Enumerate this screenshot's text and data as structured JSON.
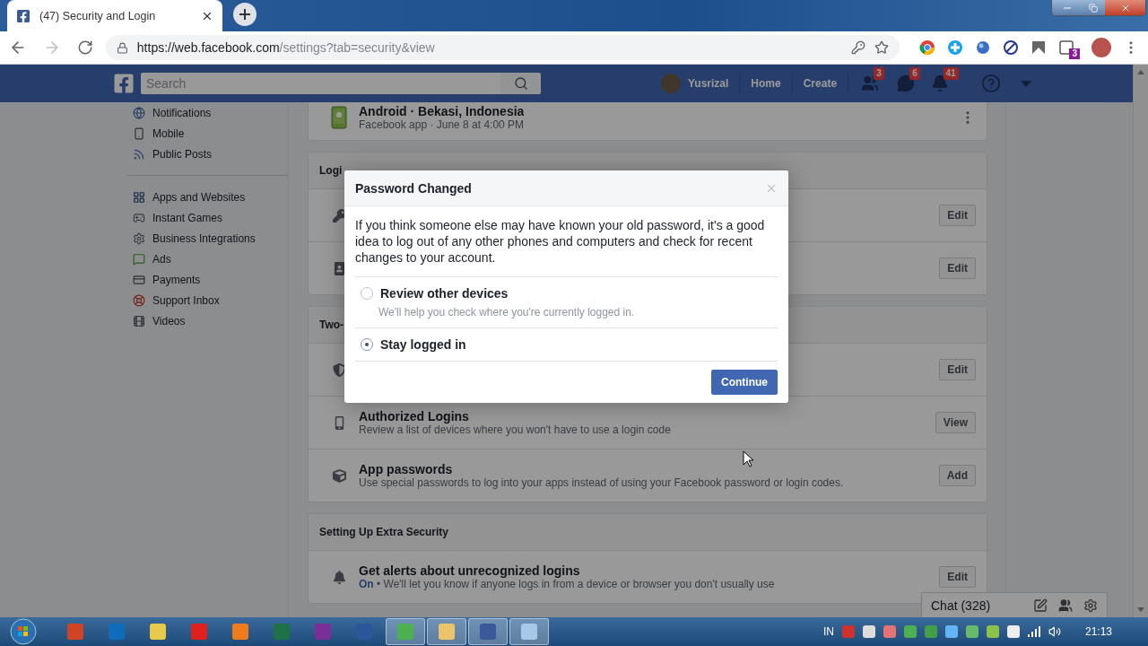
{
  "browser": {
    "tab_title": "(47) Security and Login",
    "url": {
      "host": "https://web.facebook.com",
      "path": "/settings?tab=security&view"
    },
    "extension_badge": "3"
  },
  "fb_header": {
    "search_placeholder": "Search",
    "user": "Yusrizal",
    "nav": [
      "Home",
      "Create"
    ],
    "badges": [
      {
        "kind": "friends",
        "count": "3"
      },
      {
        "kind": "messages",
        "count": "6"
      },
      {
        "kind": "notifications",
        "count": "41"
      }
    ]
  },
  "sidebar": {
    "groups": [
      [
        {
          "kind": "globe",
          "label": "Notifications"
        },
        {
          "kind": "phone",
          "label": "Mobile"
        },
        {
          "kind": "rss",
          "label": "Public Posts"
        }
      ],
      [
        {
          "kind": "apps",
          "label": "Apps and Websites"
        },
        {
          "kind": "games",
          "label": "Instant Games"
        },
        {
          "kind": "business",
          "label": "Business Integrations"
        },
        {
          "kind": "ads",
          "label": "Ads"
        },
        {
          "kind": "payments",
          "label": "Payments"
        },
        {
          "kind": "support",
          "label": "Support Inbox"
        },
        {
          "kind": "videos",
          "label": "Videos"
        }
      ]
    ]
  },
  "panels": [
    {
      "rows": [
        {
          "kind": "android",
          "title": "Android · Bekasi, Indonesia",
          "subtitle": "Facebook app · June 8 at 4:00 PM"
        }
      ]
    },
    {
      "header": "Logi",
      "rows": [
        {
          "kind": "key",
          "action": "Edit"
        },
        {
          "kind": "portrait",
          "action": "Edit"
        }
      ]
    },
    {
      "header": "Two-",
      "rows": [
        {
          "kind": "shield",
          "action": "Edit"
        },
        {
          "kind": "phone",
          "title": "Authorized Logins",
          "subtitle": "Review a list of devices where you won't have to use a login code",
          "action": "View"
        },
        {
          "kind": "cube",
          "title": "App passwords",
          "subtitle": "Use special passwords to log into your apps instead of using your Facebook password or login codes.",
          "action": "Add"
        }
      ]
    },
    {
      "header": "Setting Up Extra Security",
      "rows": [
        {
          "kind": "bell",
          "title": "Get alerts about unrecognized logins",
          "status": "On",
          "subtitle": " • We'll let you know if anyone logs in from a device or browser you don't usually use",
          "action": "Edit"
        }
      ]
    }
  ],
  "modal": {
    "title": "Password Changed",
    "body": "If you think someone else may have known your old password, it's a good idea to log out of any other phones and computers and check for recent changes to your account.",
    "options": [
      {
        "label": "Review other devices",
        "hint": "We'll help you check where you're currently logged in.",
        "selected": false
      },
      {
        "label": "Stay logged in",
        "selected": true
      }
    ],
    "button": "Continue"
  },
  "chat": {
    "label": "Chat (328)"
  },
  "taskbar": {
    "apps": [
      {
        "kind": "powerpoint",
        "open": false
      },
      {
        "kind": "outlook",
        "open": false
      },
      {
        "kind": "notes",
        "open": false
      },
      {
        "kind": "opera",
        "open": false
      },
      {
        "kind": "firefox",
        "open": false
      },
      {
        "kind": "excel",
        "open": false
      },
      {
        "kind": "onenote",
        "open": false
      },
      {
        "kind": "word",
        "open": false
      },
      {
        "kind": "chrome",
        "open": true
      },
      {
        "kind": "folder",
        "open": true
      },
      {
        "kind": "facebook",
        "open": true
      },
      {
        "kind": "notepad",
        "open": true
      }
    ],
    "language": "IN",
    "time": "21:13"
  }
}
